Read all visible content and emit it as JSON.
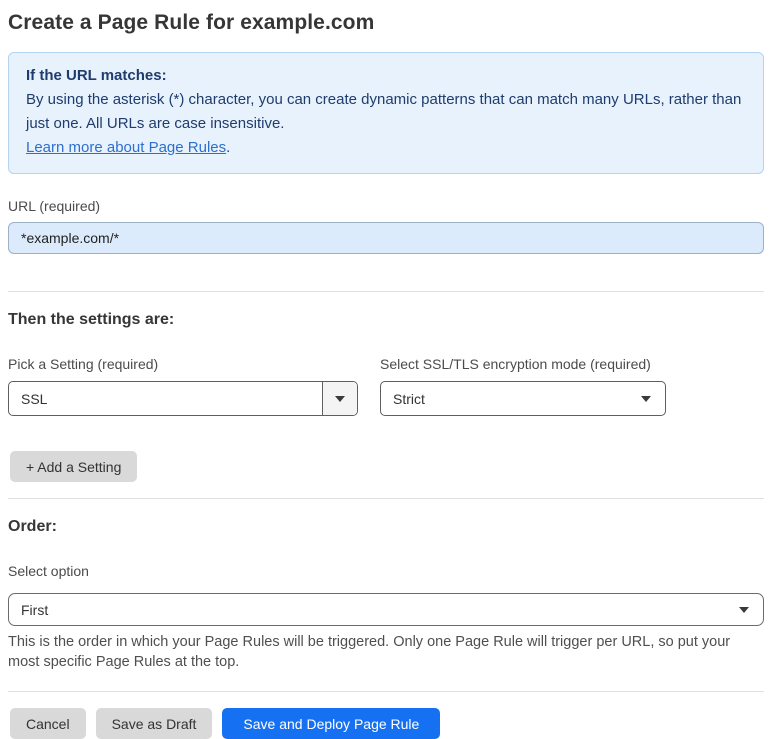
{
  "page": {
    "title": "Create a Page Rule for example.com"
  },
  "info_box": {
    "heading": "If the URL matches:",
    "body": "By using the asterisk (*) character, you can create dynamic patterns that can match many URLs, rather than just one. All URLs are case insensitive.",
    "link_label": "Learn more about Page Rules",
    "link_suffix": "."
  },
  "url_field": {
    "label": "URL (required)",
    "value": "*example.com/*"
  },
  "settings_section": {
    "heading": "Then the settings are:",
    "setting_picker": {
      "label": "Pick a Setting (required)",
      "value": "SSL"
    },
    "ssl_mode_picker": {
      "label": "Select SSL/TLS encryption mode (required)",
      "value": "Strict"
    },
    "add_setting_label": "+ Add a Setting"
  },
  "order_section": {
    "heading": "Order:",
    "select_label": "Select option",
    "select_value": "First",
    "help_text": "This is the order in which your Page Rules will be triggered. Only one Page Rule will trigger per URL, so put your most specific Page Rules at the top."
  },
  "actions": {
    "cancel": "Cancel",
    "save_draft": "Save as Draft",
    "save_deploy": "Save and Deploy Page Rule"
  },
  "colors": {
    "accent_blue": "#1671f2",
    "info_bg": "#e8f2fc",
    "info_border": "#b0d4f1",
    "info_text": "#1e3c6e",
    "link_blue": "#2c6fd1",
    "input_bg": "#dcebfc"
  }
}
